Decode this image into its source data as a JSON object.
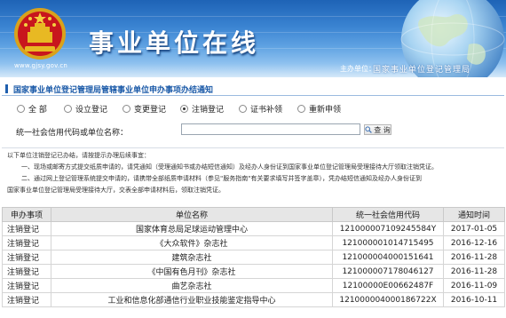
{
  "banner": {
    "site_url": "www.gjsy.gov.cn",
    "title": "事业单位在线",
    "host_label": "主办单位：",
    "host_name": "国家事业单位登记管理局"
  },
  "notice_title": "国家事业单位登记管理局管辖事业单位申办事项办结通知",
  "filters": {
    "options": [
      "全 部",
      "设立登记",
      "变更登记",
      "注销登记",
      "证书补领",
      "重新申领"
    ],
    "selected": "注销登记"
  },
  "search": {
    "label": "统一社会信用代码或单位名称：",
    "value": "",
    "button_label": "查 询"
  },
  "instructions": {
    "intro": "以下单位注销登记已办结，请按提示办理后续事宜：",
    "item1": "一、现场或邮寄方式提交纸质申请的，请凭通知（受理通知书或办结短信通知）及经办人身份证到国家事业单位登记管理局受理接待大厅领取注销凭证。",
    "item2a": "二、通过网上登记管理系统提交申请的，请携带全部纸质申请材料（参见\"服务指南\"有关要求填写并签字盖章），凭办结短信通知及经办人身份证到",
    "item2b": "国家事业单位登记管理局受理接待大厅，交表全部申请材料后，领取注销凭证。"
  },
  "table": {
    "headers": [
      "申办事项",
      "单位名称",
      "统一社会信用代码",
      "通知时间"
    ],
    "rows": [
      {
        "type": "注销登记",
        "name": "国家体育总局足球运动管理中心",
        "code": "121000007109245584Y",
        "date": "2017-01-05"
      },
      {
        "type": "注销登记",
        "name": "《大众软件》杂志社",
        "code": "121000001014715495",
        "date": "2016-12-16"
      },
      {
        "type": "注销登记",
        "name": "建筑杂志社",
        "code": "121000004000151641",
        "date": "2016-11-28"
      },
      {
        "type": "注销登记",
        "name": "《中国有色月刊》杂志社",
        "code": "121000007178046127",
        "date": "2016-11-28"
      },
      {
        "type": "注销登记",
        "name": "曲艺杂志社",
        "code": "12100000E00662487F",
        "date": "2016-11-09"
      },
      {
        "type": "注销登记",
        "name": "工业和信息化部通信行业职业技能鉴定指导中心",
        "code": "121000004000186722X",
        "date": "2016-10-11"
      }
    ]
  },
  "colors": {
    "banner_blue": "#1e63b6",
    "notice_text": "#1b5aa8",
    "header_bg": "#e6e6e6"
  }
}
